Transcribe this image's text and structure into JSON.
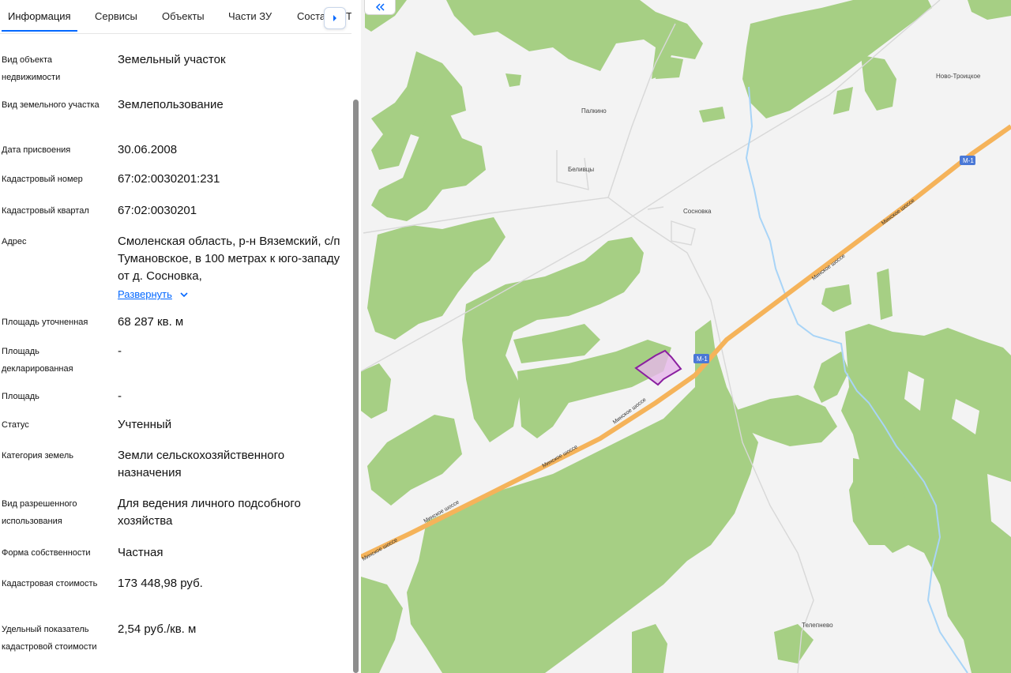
{
  "tabs": [
    "Информация",
    "Сервисы",
    "Объекты",
    "Части ЗУ",
    "Соста",
    "Т"
  ],
  "rows": [
    {
      "label": "Вид объекта недвижимости",
      "value": "Земельный участок"
    },
    {
      "label": "Вид земельного участка",
      "value": "Землепользование"
    },
    {
      "label": "Дата присвоения",
      "value": "30.06.2008"
    },
    {
      "label": "Кадастровый номер",
      "value": "67:02:0030201:231"
    },
    {
      "label": "Кадастровый квартал",
      "value": "67:02:0030201"
    },
    {
      "label": "Адрес",
      "value": "Смоленская область, р-н Вяземский, с/п Тумановское, в 100 метрах к юго-западу от д. Сосновка,",
      "expand": "Развернуть"
    },
    {
      "label": "Площадь уточненная",
      "value": "68 287 кв. м"
    },
    {
      "label": "Площадь декларированная",
      "value": "-"
    },
    {
      "label": "Площадь",
      "value": "-"
    },
    {
      "label": "Статус",
      "value": "Учтенный"
    },
    {
      "label": "Категория земель",
      "value": "Земли сельскохозяйственного назначения"
    },
    {
      "label": "Вид разрешенного использования",
      "value": "Для ведения личного подсобного хозяйства"
    },
    {
      "label": "Форма собственности",
      "value": "Частная"
    },
    {
      "label": "Кадастровая стоимость",
      "value": "173 448,98 руб."
    },
    {
      "label": "Удельный показатель кадастровой стоимости",
      "value": "2,54 руб./кв. м"
    }
  ],
  "map": {
    "places": [
      "Палкино",
      "Беливцы",
      "Сосновка",
      "Ново-Троицкое",
      "Телепнево"
    ],
    "road_badge": "М-1",
    "road_name": "Минское шоссе",
    "colors": {
      "forest": "#a6cf84",
      "field": "#f3f3f3",
      "highway": "#f5b35a",
      "river": "#a8d4f7",
      "parcel": "#e6b6ea",
      "parcel_stroke": "#8a1fa0"
    }
  },
  "icons": {
    "tab_arrow": "chevron-right-icon",
    "collapse": "double-chevron-left-icon",
    "expand": "chevron-down-icon"
  }
}
